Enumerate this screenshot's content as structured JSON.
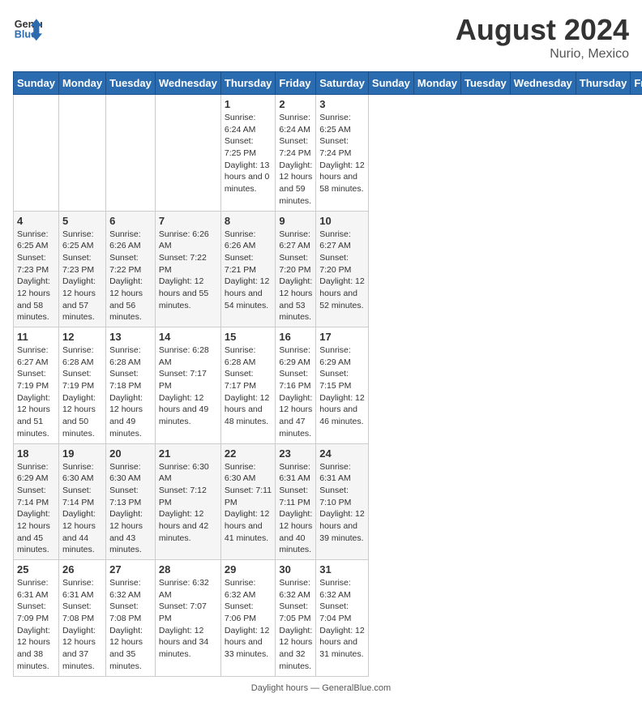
{
  "header": {
    "logo_line1": "General",
    "logo_line2": "Blue",
    "month_year": "August 2024",
    "location": "Nurio, Mexico"
  },
  "days_of_week": [
    "Sunday",
    "Monday",
    "Tuesday",
    "Wednesday",
    "Thursday",
    "Friday",
    "Saturday"
  ],
  "weeks": [
    [
      {
        "day": "",
        "info": ""
      },
      {
        "day": "",
        "info": ""
      },
      {
        "day": "",
        "info": ""
      },
      {
        "day": "",
        "info": ""
      },
      {
        "day": "1",
        "info": "Sunrise: 6:24 AM\nSunset: 7:25 PM\nDaylight: 13 hours and 0 minutes."
      },
      {
        "day": "2",
        "info": "Sunrise: 6:24 AM\nSunset: 7:24 PM\nDaylight: 12 hours and 59 minutes."
      },
      {
        "day": "3",
        "info": "Sunrise: 6:25 AM\nSunset: 7:24 PM\nDaylight: 12 hours and 58 minutes."
      }
    ],
    [
      {
        "day": "4",
        "info": "Sunrise: 6:25 AM\nSunset: 7:23 PM\nDaylight: 12 hours and 58 minutes."
      },
      {
        "day": "5",
        "info": "Sunrise: 6:25 AM\nSunset: 7:23 PM\nDaylight: 12 hours and 57 minutes."
      },
      {
        "day": "6",
        "info": "Sunrise: 6:26 AM\nSunset: 7:22 PM\nDaylight: 12 hours and 56 minutes."
      },
      {
        "day": "7",
        "info": "Sunrise: 6:26 AM\nSunset: 7:22 PM\nDaylight: 12 hours and 55 minutes."
      },
      {
        "day": "8",
        "info": "Sunrise: 6:26 AM\nSunset: 7:21 PM\nDaylight: 12 hours and 54 minutes."
      },
      {
        "day": "9",
        "info": "Sunrise: 6:27 AM\nSunset: 7:20 PM\nDaylight: 12 hours and 53 minutes."
      },
      {
        "day": "10",
        "info": "Sunrise: 6:27 AM\nSunset: 7:20 PM\nDaylight: 12 hours and 52 minutes."
      }
    ],
    [
      {
        "day": "11",
        "info": "Sunrise: 6:27 AM\nSunset: 7:19 PM\nDaylight: 12 hours and 51 minutes."
      },
      {
        "day": "12",
        "info": "Sunrise: 6:28 AM\nSunset: 7:19 PM\nDaylight: 12 hours and 50 minutes."
      },
      {
        "day": "13",
        "info": "Sunrise: 6:28 AM\nSunset: 7:18 PM\nDaylight: 12 hours and 49 minutes."
      },
      {
        "day": "14",
        "info": "Sunrise: 6:28 AM\nSunset: 7:17 PM\nDaylight: 12 hours and 49 minutes."
      },
      {
        "day": "15",
        "info": "Sunrise: 6:28 AM\nSunset: 7:17 PM\nDaylight: 12 hours and 48 minutes."
      },
      {
        "day": "16",
        "info": "Sunrise: 6:29 AM\nSunset: 7:16 PM\nDaylight: 12 hours and 47 minutes."
      },
      {
        "day": "17",
        "info": "Sunrise: 6:29 AM\nSunset: 7:15 PM\nDaylight: 12 hours and 46 minutes."
      }
    ],
    [
      {
        "day": "18",
        "info": "Sunrise: 6:29 AM\nSunset: 7:14 PM\nDaylight: 12 hours and 45 minutes."
      },
      {
        "day": "19",
        "info": "Sunrise: 6:30 AM\nSunset: 7:14 PM\nDaylight: 12 hours and 44 minutes."
      },
      {
        "day": "20",
        "info": "Sunrise: 6:30 AM\nSunset: 7:13 PM\nDaylight: 12 hours and 43 minutes."
      },
      {
        "day": "21",
        "info": "Sunrise: 6:30 AM\nSunset: 7:12 PM\nDaylight: 12 hours and 42 minutes."
      },
      {
        "day": "22",
        "info": "Sunrise: 6:30 AM\nSunset: 7:11 PM\nDaylight: 12 hours and 41 minutes."
      },
      {
        "day": "23",
        "info": "Sunrise: 6:31 AM\nSunset: 7:11 PM\nDaylight: 12 hours and 40 minutes."
      },
      {
        "day": "24",
        "info": "Sunrise: 6:31 AM\nSunset: 7:10 PM\nDaylight: 12 hours and 39 minutes."
      }
    ],
    [
      {
        "day": "25",
        "info": "Sunrise: 6:31 AM\nSunset: 7:09 PM\nDaylight: 12 hours and 38 minutes."
      },
      {
        "day": "26",
        "info": "Sunrise: 6:31 AM\nSunset: 7:08 PM\nDaylight: 12 hours and 37 minutes."
      },
      {
        "day": "27",
        "info": "Sunrise: 6:32 AM\nSunset: 7:08 PM\nDaylight: 12 hours and 35 minutes."
      },
      {
        "day": "28",
        "info": "Sunrise: 6:32 AM\nSunset: 7:07 PM\nDaylight: 12 hours and 34 minutes."
      },
      {
        "day": "29",
        "info": "Sunrise: 6:32 AM\nSunset: 7:06 PM\nDaylight: 12 hours and 33 minutes."
      },
      {
        "day": "30",
        "info": "Sunrise: 6:32 AM\nSunset: 7:05 PM\nDaylight: 12 hours and 32 minutes."
      },
      {
        "day": "31",
        "info": "Sunrise: 6:32 AM\nSunset: 7:04 PM\nDaylight: 12 hours and 31 minutes."
      }
    ]
  ],
  "footer": {
    "text": "Daylight hours",
    "source": "GeneralBlue.com"
  }
}
